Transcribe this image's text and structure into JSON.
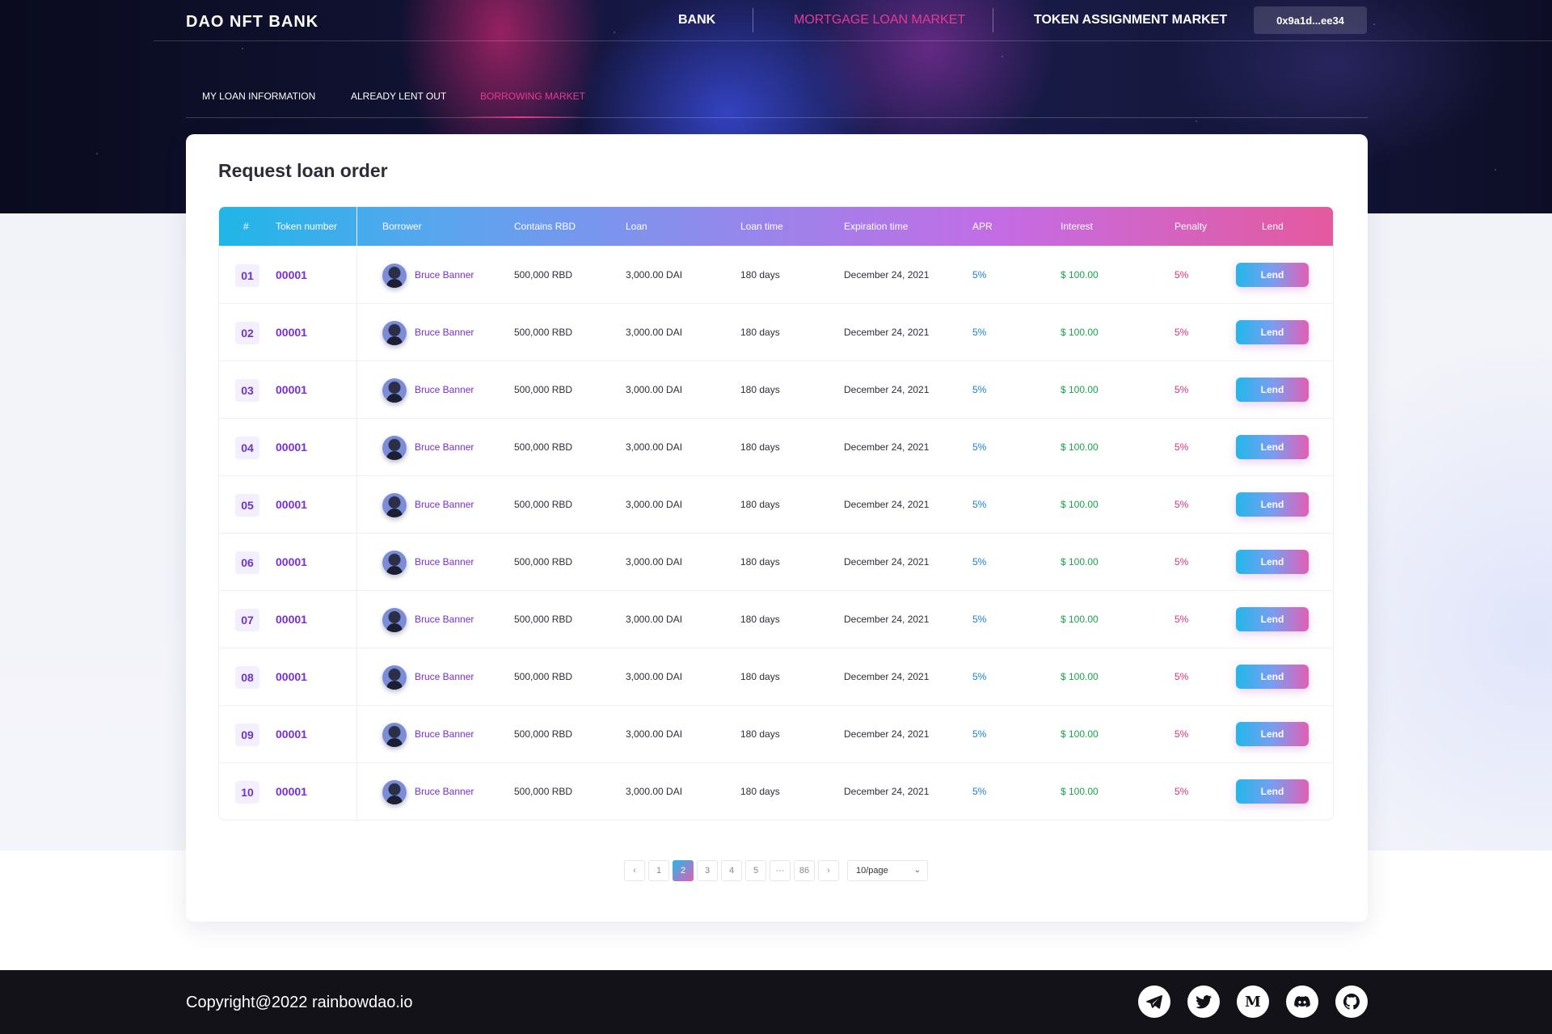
{
  "app": {
    "logo": "DAO NFT BANK",
    "nav": [
      "BANK",
      "MORTGAGE LOAN MARKET",
      "TOKEN ASSIGNMENT MARKET"
    ],
    "active_nav": "MORTGAGE LOAN MARKET",
    "wallet": "0x9a1d...ee34",
    "accent_color": "#e53b91"
  },
  "subtabs": [
    "MY LOAN INFORMATION",
    "ALREADY LENT OUT",
    "BORROWING MARKET"
  ],
  "active_subtab": "BORROWING MARKET",
  "card": {
    "title": "Request loan order"
  },
  "table": {
    "headers": [
      "#",
      "Token number",
      "Borrower",
      "Contains RBD",
      "Loan",
      "Loan time",
      "Expiration time",
      "APR",
      "Interest",
      "Penalty",
      "Lend"
    ],
    "rows": [
      {
        "idx": "01",
        "token": "00001",
        "borrower": "Bruce Banner",
        "rbd": "500,000 RBD",
        "loan": "3,000.00 DAI",
        "loan_time": "180 days",
        "expiration": "December 24, 2021",
        "apr": "5%",
        "interest": "$ 100.00",
        "penalty": "5%",
        "action": "Lend"
      },
      {
        "idx": "02",
        "token": "00001",
        "borrower": "Bruce Banner",
        "rbd": "500,000 RBD",
        "loan": "3,000.00 DAI",
        "loan_time": "180 days",
        "expiration": "December 24, 2021",
        "apr": "5%",
        "interest": "$ 100.00",
        "penalty": "5%",
        "action": "Lend"
      },
      {
        "idx": "03",
        "token": "00001",
        "borrower": "Bruce Banner",
        "rbd": "500,000 RBD",
        "loan": "3,000.00 DAI",
        "loan_time": "180 days",
        "expiration": "December 24, 2021",
        "apr": "5%",
        "interest": "$ 100.00",
        "penalty": "5%",
        "action": "Lend"
      },
      {
        "idx": "04",
        "token": "00001",
        "borrower": "Bruce Banner",
        "rbd": "500,000 RBD",
        "loan": "3,000.00 DAI",
        "loan_time": "180 days",
        "expiration": "December 24, 2021",
        "apr": "5%",
        "interest": "$ 100.00",
        "penalty": "5%",
        "action": "Lend"
      },
      {
        "idx": "05",
        "token": "00001",
        "borrower": "Bruce Banner",
        "rbd": "500,000 RBD",
        "loan": "3,000.00 DAI",
        "loan_time": "180 days",
        "expiration": "December 24, 2021",
        "apr": "5%",
        "interest": "$ 100.00",
        "penalty": "5%",
        "action": "Lend"
      },
      {
        "idx": "06",
        "token": "00001",
        "borrower": "Bruce Banner",
        "rbd": "500,000 RBD",
        "loan": "3,000.00 DAI",
        "loan_time": "180 days",
        "expiration": "December 24, 2021",
        "apr": "5%",
        "interest": "$ 100.00",
        "penalty": "5%",
        "action": "Lend"
      },
      {
        "idx": "07",
        "token": "00001",
        "borrower": "Bruce Banner",
        "rbd": "500,000 RBD",
        "loan": "3,000.00 DAI",
        "loan_time": "180 days",
        "expiration": "December 24, 2021",
        "apr": "5%",
        "interest": "$ 100.00",
        "penalty": "5%",
        "action": "Lend"
      },
      {
        "idx": "08",
        "token": "00001",
        "borrower": "Bruce Banner",
        "rbd": "500,000 RBD",
        "loan": "3,000.00 DAI",
        "loan_time": "180 days",
        "expiration": "December 24, 2021",
        "apr": "5%",
        "interest": "$ 100.00",
        "penalty": "5%",
        "action": "Lend"
      },
      {
        "idx": "09",
        "token": "00001",
        "borrower": "Bruce Banner",
        "rbd": "500,000 RBD",
        "loan": "3,000.00 DAI",
        "loan_time": "180 days",
        "expiration": "December 24, 2021",
        "apr": "5%",
        "interest": "$ 100.00",
        "penalty": "5%",
        "action": "Lend"
      },
      {
        "idx": "10",
        "token": "00001",
        "borrower": "Bruce Banner",
        "rbd": "500,000 RBD",
        "loan": "3,000.00 DAI",
        "loan_time": "180 days",
        "expiration": "December 24, 2021",
        "apr": "5%",
        "interest": "$ 100.00",
        "penalty": "5%",
        "action": "Lend"
      }
    ]
  },
  "pagination": {
    "prev": "‹",
    "pages": [
      "1",
      "2",
      "3",
      "4",
      "5",
      "···",
      "86"
    ],
    "current": "2",
    "next": "›",
    "page_size": "10/page",
    "page_size_icon": "chevron-down-icon"
  },
  "footer": {
    "copyright": "Copyright@2022 rainbowdao.io",
    "social": [
      "telegram-icon",
      "twitter-icon",
      "medium-icon",
      "discord-icon",
      "github-icon"
    ]
  }
}
